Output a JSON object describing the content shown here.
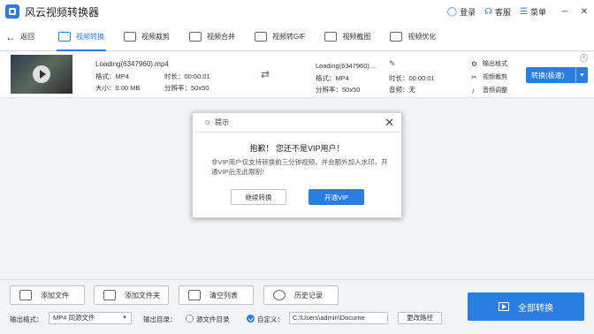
{
  "app": {
    "title": "风云视频转换器",
    "login": "登录",
    "service": "客服",
    "menu": "菜单",
    "minimize": "─",
    "close": "✕"
  },
  "toolbar": {
    "back": "返回",
    "tabs": [
      {
        "label": "视频转换",
        "icon": "video-convert-icon",
        "active": true
      },
      {
        "label": "视频裁剪",
        "icon": "video-crop-icon",
        "active": false
      },
      {
        "label": "视频合并",
        "icon": "video-merge-icon",
        "active": false
      },
      {
        "label": "视频转GIF",
        "icon": "gif-icon",
        "active": false
      },
      {
        "label": "视频截图",
        "icon": "screenshot-icon",
        "active": false
      },
      {
        "label": "视频优化",
        "icon": "optimize-icon",
        "active": false
      }
    ]
  },
  "file": {
    "src_name": "Loading(6347960).mp4",
    "src_format": "格式：MP4",
    "src_duration": "时长：00:00:01",
    "src_size": "大小：0.00 MB",
    "src_resolution": "分辨率：50x50",
    "dst_name": "Loading(6347960)....",
    "dst_format": "格式：MP4",
    "dst_duration": "时长：00:00:01",
    "dst_resolution": "分辨率：50x50",
    "dst_audio": "音频：无",
    "links": [
      "输出格式",
      "视频裁剪",
      "音频调整"
    ],
    "convert_button": "转换(极速)"
  },
  "dialog": {
    "title": "提示",
    "main": "抱歉！ 您还不是VIP用户！",
    "sub": "非VIP用户仅支持转换前三分钟视频，并会额外加入水印，开通VIP后无此限制！",
    "continue": "继续转换",
    "open_vip": "开通VIP"
  },
  "bottom": {
    "add_file": "添加文件",
    "add_folder": "添加文件夹",
    "clear_list": "清空列表",
    "history": "历史记录",
    "convert_all": "全部转换",
    "output_format_label": "输出格式：",
    "output_format_value": "MP4 同源文件",
    "output_dir_label": "输出目录：",
    "source_dir": "源文件目录",
    "custom": "自定义：",
    "path": "C:\\Users\\admin\\Docume",
    "change_path": "更改路径"
  },
  "colors": {
    "accent": "#2a7de1"
  }
}
